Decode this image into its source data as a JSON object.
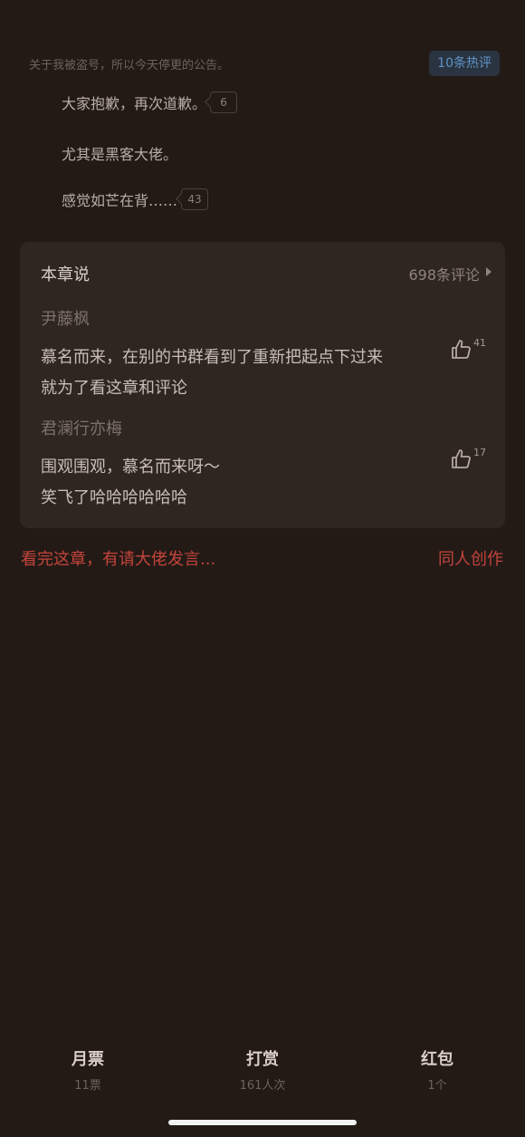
{
  "header": {
    "notice": "关于我被盗号，所以今天停更的公告。",
    "hot_comments": "10条热评"
  },
  "lines": [
    {
      "text": "大家抱歉，再次道歉。",
      "count": "6"
    },
    {
      "text": "尤其是黑客大佬。"
    },
    {
      "text": "感觉如芒在背……",
      "count": "43"
    }
  ],
  "chapter_card": {
    "title": "本章说",
    "comment_count": "698条评论",
    "comments": [
      {
        "user": "尹藤枫",
        "line1": "慕名而来，在别的书群看到了重新把起点下过来",
        "line2": "就为了看这章和评论",
        "likes": "41"
      },
      {
        "user": "君澜行亦梅",
        "line1": "围观围观，慕名而来呀～",
        "line2": "笑飞了哈哈哈哈哈哈",
        "likes": "17"
      }
    ]
  },
  "prompt": "看完这章，有请大佬发言...",
  "fan_fiction": "同人创作",
  "tabbar": {
    "monthly": {
      "title": "月票",
      "sub": "11票"
    },
    "reward": {
      "title": "打赏",
      "sub": "161人次"
    },
    "redpacket": {
      "title": "红包",
      "sub": "1个"
    }
  },
  "colors": {
    "background": "#231a16",
    "accent_red": "#c4443c",
    "badge_blue": "#5e93c8"
  }
}
